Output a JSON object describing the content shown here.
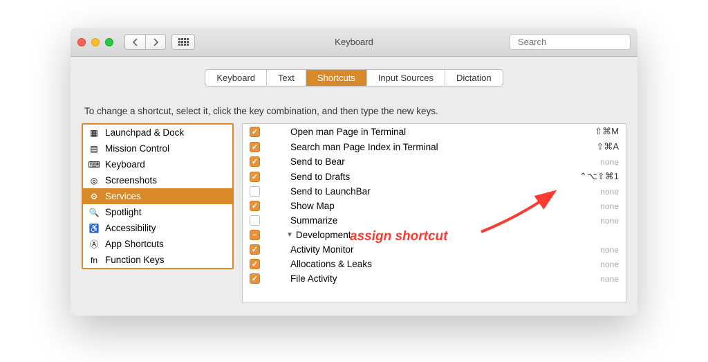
{
  "window": {
    "title": "Keyboard",
    "search_placeholder": "Search"
  },
  "tabs": [
    {
      "label": "Keyboard",
      "active": false
    },
    {
      "label": "Text",
      "active": false
    },
    {
      "label": "Shortcuts",
      "active": true
    },
    {
      "label": "Input Sources",
      "active": false
    },
    {
      "label": "Dictation",
      "active": false
    }
  ],
  "instruction": "To change a shortcut, select it, click the key combination, and then type the new keys.",
  "sidebar": [
    {
      "icon": "launchpad-icon",
      "label": "Launchpad & Dock"
    },
    {
      "icon": "mission-control-icon",
      "label": "Mission Control"
    },
    {
      "icon": "keyboard-icon",
      "label": "Keyboard"
    },
    {
      "icon": "screenshots-icon",
      "label": "Screenshots"
    },
    {
      "icon": "services-icon",
      "label": "Services",
      "selected": true
    },
    {
      "icon": "spotlight-icon",
      "label": "Spotlight"
    },
    {
      "icon": "accessibility-icon",
      "label": "Accessibility"
    },
    {
      "icon": "app-shortcuts-icon",
      "label": "App Shortcuts"
    },
    {
      "icon": "function-keys-icon",
      "label": "Function Keys"
    }
  ],
  "services": [
    {
      "checked": true,
      "name": "Open man Page in Terminal",
      "shortcut": "⇧⌘M"
    },
    {
      "checked": true,
      "name": "Search man Page Index in Terminal",
      "shortcut": "⇧⌘A"
    },
    {
      "checked": true,
      "name": "Send to Bear",
      "shortcut": "none"
    },
    {
      "checked": true,
      "name": "Send to Drafts",
      "shortcut": "⌃⌥⇧⌘1"
    },
    {
      "checked": false,
      "name": "Send to LaunchBar",
      "shortcut": "none"
    },
    {
      "checked": true,
      "name": "Show Map",
      "shortcut": "none"
    },
    {
      "checked": false,
      "name": "Summarize",
      "shortcut": "none"
    }
  ],
  "group": {
    "label": "Development",
    "state": "mixed"
  },
  "group_items": [
    {
      "checked": true,
      "name": "Activity Monitor",
      "shortcut": "none"
    },
    {
      "checked": true,
      "name": "Allocations & Leaks",
      "shortcut": "none"
    },
    {
      "checked": true,
      "name": "File Activity",
      "shortcut": "none"
    }
  ],
  "annotation": {
    "text": "assign shortcut"
  }
}
